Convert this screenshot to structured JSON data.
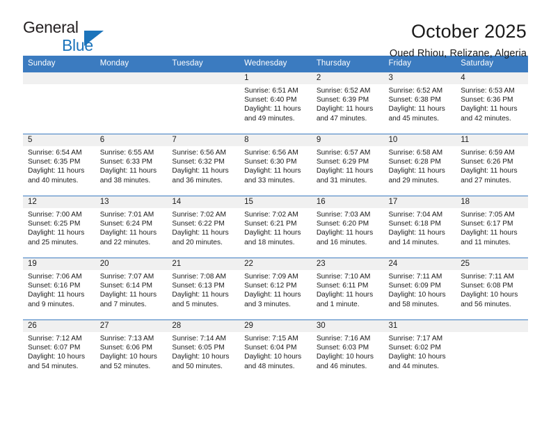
{
  "brand": {
    "name_part1": "General",
    "name_part2": "Blue",
    "triangle_color": "#1c74bb"
  },
  "header": {
    "title": "October 2025",
    "subtitle": "Oued Rhiou, Relizane, Algeria"
  },
  "theme": {
    "header_blue": "#3b7bc0",
    "daynum_strip": "#f0f0f0",
    "text": "#1a1a1a"
  },
  "weekdays": [
    "Sunday",
    "Monday",
    "Tuesday",
    "Wednesday",
    "Thursday",
    "Friday",
    "Saturday"
  ],
  "weeks": [
    [
      {
        "day": "",
        "empty": true,
        "sunrise": "",
        "sunset": "",
        "daylight1": "",
        "daylight2": ""
      },
      {
        "day": "",
        "empty": true,
        "sunrise": "",
        "sunset": "",
        "daylight1": "",
        "daylight2": ""
      },
      {
        "day": "",
        "empty": true,
        "sunrise": "",
        "sunset": "",
        "daylight1": "",
        "daylight2": ""
      },
      {
        "day": "1",
        "empty": false,
        "sunrise": "Sunrise: 6:51 AM",
        "sunset": "Sunset: 6:40 PM",
        "daylight1": "Daylight: 11 hours",
        "daylight2": "and 49 minutes."
      },
      {
        "day": "2",
        "empty": false,
        "sunrise": "Sunrise: 6:52 AM",
        "sunset": "Sunset: 6:39 PM",
        "daylight1": "Daylight: 11 hours",
        "daylight2": "and 47 minutes."
      },
      {
        "day": "3",
        "empty": false,
        "sunrise": "Sunrise: 6:52 AM",
        "sunset": "Sunset: 6:38 PM",
        "daylight1": "Daylight: 11 hours",
        "daylight2": "and 45 minutes."
      },
      {
        "day": "4",
        "empty": false,
        "sunrise": "Sunrise: 6:53 AM",
        "sunset": "Sunset: 6:36 PM",
        "daylight1": "Daylight: 11 hours",
        "daylight2": "and 42 minutes."
      }
    ],
    [
      {
        "day": "5",
        "empty": false,
        "sunrise": "Sunrise: 6:54 AM",
        "sunset": "Sunset: 6:35 PM",
        "daylight1": "Daylight: 11 hours",
        "daylight2": "and 40 minutes."
      },
      {
        "day": "6",
        "empty": false,
        "sunrise": "Sunrise: 6:55 AM",
        "sunset": "Sunset: 6:33 PM",
        "daylight1": "Daylight: 11 hours",
        "daylight2": "and 38 minutes."
      },
      {
        "day": "7",
        "empty": false,
        "sunrise": "Sunrise: 6:56 AM",
        "sunset": "Sunset: 6:32 PM",
        "daylight1": "Daylight: 11 hours",
        "daylight2": "and 36 minutes."
      },
      {
        "day": "8",
        "empty": false,
        "sunrise": "Sunrise: 6:56 AM",
        "sunset": "Sunset: 6:30 PM",
        "daylight1": "Daylight: 11 hours",
        "daylight2": "and 33 minutes."
      },
      {
        "day": "9",
        "empty": false,
        "sunrise": "Sunrise: 6:57 AM",
        "sunset": "Sunset: 6:29 PM",
        "daylight1": "Daylight: 11 hours",
        "daylight2": "and 31 minutes."
      },
      {
        "day": "10",
        "empty": false,
        "sunrise": "Sunrise: 6:58 AM",
        "sunset": "Sunset: 6:28 PM",
        "daylight1": "Daylight: 11 hours",
        "daylight2": "and 29 minutes."
      },
      {
        "day": "11",
        "empty": false,
        "sunrise": "Sunrise: 6:59 AM",
        "sunset": "Sunset: 6:26 PM",
        "daylight1": "Daylight: 11 hours",
        "daylight2": "and 27 minutes."
      }
    ],
    [
      {
        "day": "12",
        "empty": false,
        "sunrise": "Sunrise: 7:00 AM",
        "sunset": "Sunset: 6:25 PM",
        "daylight1": "Daylight: 11 hours",
        "daylight2": "and 25 minutes."
      },
      {
        "day": "13",
        "empty": false,
        "sunrise": "Sunrise: 7:01 AM",
        "sunset": "Sunset: 6:24 PM",
        "daylight1": "Daylight: 11 hours",
        "daylight2": "and 22 minutes."
      },
      {
        "day": "14",
        "empty": false,
        "sunrise": "Sunrise: 7:02 AM",
        "sunset": "Sunset: 6:22 PM",
        "daylight1": "Daylight: 11 hours",
        "daylight2": "and 20 minutes."
      },
      {
        "day": "15",
        "empty": false,
        "sunrise": "Sunrise: 7:02 AM",
        "sunset": "Sunset: 6:21 PM",
        "daylight1": "Daylight: 11 hours",
        "daylight2": "and 18 minutes."
      },
      {
        "day": "16",
        "empty": false,
        "sunrise": "Sunrise: 7:03 AM",
        "sunset": "Sunset: 6:20 PM",
        "daylight1": "Daylight: 11 hours",
        "daylight2": "and 16 minutes."
      },
      {
        "day": "17",
        "empty": false,
        "sunrise": "Sunrise: 7:04 AM",
        "sunset": "Sunset: 6:18 PM",
        "daylight1": "Daylight: 11 hours",
        "daylight2": "and 14 minutes."
      },
      {
        "day": "18",
        "empty": false,
        "sunrise": "Sunrise: 7:05 AM",
        "sunset": "Sunset: 6:17 PM",
        "daylight1": "Daylight: 11 hours",
        "daylight2": "and 11 minutes."
      }
    ],
    [
      {
        "day": "19",
        "empty": false,
        "sunrise": "Sunrise: 7:06 AM",
        "sunset": "Sunset: 6:16 PM",
        "daylight1": "Daylight: 11 hours",
        "daylight2": "and 9 minutes."
      },
      {
        "day": "20",
        "empty": false,
        "sunrise": "Sunrise: 7:07 AM",
        "sunset": "Sunset: 6:14 PM",
        "daylight1": "Daylight: 11 hours",
        "daylight2": "and 7 minutes."
      },
      {
        "day": "21",
        "empty": false,
        "sunrise": "Sunrise: 7:08 AM",
        "sunset": "Sunset: 6:13 PM",
        "daylight1": "Daylight: 11 hours",
        "daylight2": "and 5 minutes."
      },
      {
        "day": "22",
        "empty": false,
        "sunrise": "Sunrise: 7:09 AM",
        "sunset": "Sunset: 6:12 PM",
        "daylight1": "Daylight: 11 hours",
        "daylight2": "and 3 minutes."
      },
      {
        "day": "23",
        "empty": false,
        "sunrise": "Sunrise: 7:10 AM",
        "sunset": "Sunset: 6:11 PM",
        "daylight1": "Daylight: 11 hours",
        "daylight2": "and 1 minute."
      },
      {
        "day": "24",
        "empty": false,
        "sunrise": "Sunrise: 7:11 AM",
        "sunset": "Sunset: 6:09 PM",
        "daylight1": "Daylight: 10 hours",
        "daylight2": "and 58 minutes."
      },
      {
        "day": "25",
        "empty": false,
        "sunrise": "Sunrise: 7:11 AM",
        "sunset": "Sunset: 6:08 PM",
        "daylight1": "Daylight: 10 hours",
        "daylight2": "and 56 minutes."
      }
    ],
    [
      {
        "day": "26",
        "empty": false,
        "sunrise": "Sunrise: 7:12 AM",
        "sunset": "Sunset: 6:07 PM",
        "daylight1": "Daylight: 10 hours",
        "daylight2": "and 54 minutes."
      },
      {
        "day": "27",
        "empty": false,
        "sunrise": "Sunrise: 7:13 AM",
        "sunset": "Sunset: 6:06 PM",
        "daylight1": "Daylight: 10 hours",
        "daylight2": "and 52 minutes."
      },
      {
        "day": "28",
        "empty": false,
        "sunrise": "Sunrise: 7:14 AM",
        "sunset": "Sunset: 6:05 PM",
        "daylight1": "Daylight: 10 hours",
        "daylight2": "and 50 minutes."
      },
      {
        "day": "29",
        "empty": false,
        "sunrise": "Sunrise: 7:15 AM",
        "sunset": "Sunset: 6:04 PM",
        "daylight1": "Daylight: 10 hours",
        "daylight2": "and 48 minutes."
      },
      {
        "day": "30",
        "empty": false,
        "sunrise": "Sunrise: 7:16 AM",
        "sunset": "Sunset: 6:03 PM",
        "daylight1": "Daylight: 10 hours",
        "daylight2": "and 46 minutes."
      },
      {
        "day": "31",
        "empty": false,
        "sunrise": "Sunrise: 7:17 AM",
        "sunset": "Sunset: 6:02 PM",
        "daylight1": "Daylight: 10 hours",
        "daylight2": "and 44 minutes."
      },
      {
        "day": "",
        "empty": true,
        "sunrise": "",
        "sunset": "",
        "daylight1": "",
        "daylight2": ""
      }
    ]
  ]
}
